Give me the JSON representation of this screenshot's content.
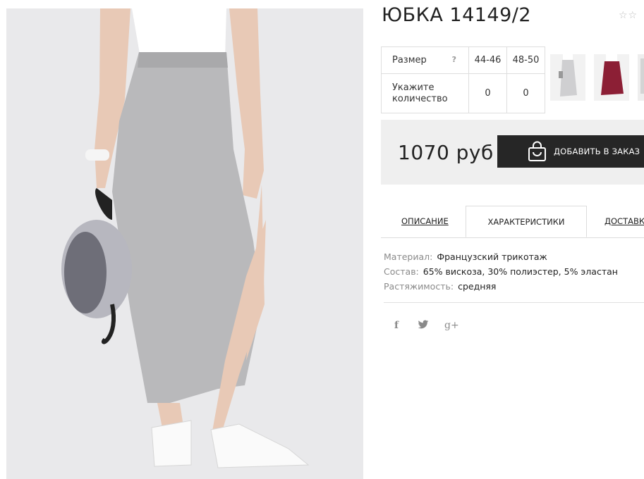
{
  "product": {
    "title": "ЮБКА 14149/2",
    "favorite_icon": "star-outline-icon"
  },
  "size_table": {
    "size_label": "Размер",
    "help_label": "?",
    "sizes": [
      "44-46",
      "48-50"
    ],
    "qty_label_line1": "Укажите",
    "qty_label_line2": "количество",
    "quantities": [
      "0",
      "0"
    ]
  },
  "thumbnails": [
    {
      "name": "thumbnail-grey-skirt",
      "color": "#cfcfd1"
    },
    {
      "name": "thumbnail-burgundy-skirt",
      "color": "#8c1f35"
    },
    {
      "name": "thumbnail-partial",
      "color": "#e0e0e0"
    }
  ],
  "purchase": {
    "price": "1070 руб",
    "order_button_label": "ДОБАВИТЬ В ЗАКАЗ",
    "order_icon": "shopping-bag-icon"
  },
  "tabs": {
    "description": "ОПИСАНИЕ",
    "characteristics": "ХАРАКТЕРИСТИКИ",
    "delivery": "ДОСТАВКА",
    "active": "characteristics"
  },
  "characteristics": [
    {
      "label": "Материал:",
      "value": "Французский трикотаж"
    },
    {
      "label": "Состав:",
      "value": "65% вискоза, 30% полиэстер, 5% эластан"
    },
    {
      "label": "Растяжимость:",
      "value": "средняя"
    }
  ],
  "social": {
    "facebook": "f",
    "twitter": "twitter-bird-icon",
    "google": "g+"
  },
  "colors": {
    "accent_button": "#262626",
    "price_panel": "#efefef",
    "skirt_grey": "#b9b9bb",
    "burgundy": "#8c1f35"
  }
}
